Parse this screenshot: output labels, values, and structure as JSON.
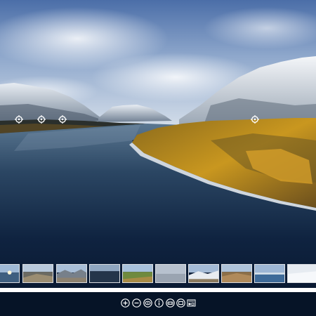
{
  "viewer": {
    "scene": "mountain-lake-aerial-panorama",
    "colors": {
      "sky_top": "#4b6ea8",
      "sky_horizon": "#c9d6e6",
      "water_near": "#08162a",
      "water_far": "#4d6a86",
      "autumn_forest": "#c9971f",
      "snow": "#eef2f6",
      "controls_bg": "#061427"
    }
  },
  "hotspots": [
    {
      "icon": "target-icon"
    },
    {
      "icon": "target-icon"
    },
    {
      "icon": "target-icon"
    },
    {
      "icon": "target-icon"
    }
  ],
  "thumbnails": [
    {
      "scene": "lake-sunrise"
    },
    {
      "scene": "rocky-shore"
    },
    {
      "scene": "mountain-valley"
    },
    {
      "scene": "dark-lake"
    },
    {
      "scene": "green-valley"
    },
    {
      "scene": "misty-plain"
    },
    {
      "scene": "snowy-ridge"
    },
    {
      "scene": "brown-hills"
    },
    {
      "scene": "blue-lake"
    },
    {
      "scene": "snow-field"
    }
  ],
  "controls": [
    {
      "name": "zoom-in",
      "icon": "plus-circle-icon"
    },
    {
      "name": "zoom-out",
      "icon": "minus-circle-icon"
    },
    {
      "name": "gyroscope",
      "icon": "gyroscope-icon"
    },
    {
      "name": "info",
      "icon": "info-icon"
    },
    {
      "name": "vr-mode",
      "icon": "vr-headset-icon"
    },
    {
      "name": "fullscreen",
      "icon": "fullscreen-icon"
    },
    {
      "name": "thumbnails",
      "icon": "thumbnails-icon"
    }
  ]
}
